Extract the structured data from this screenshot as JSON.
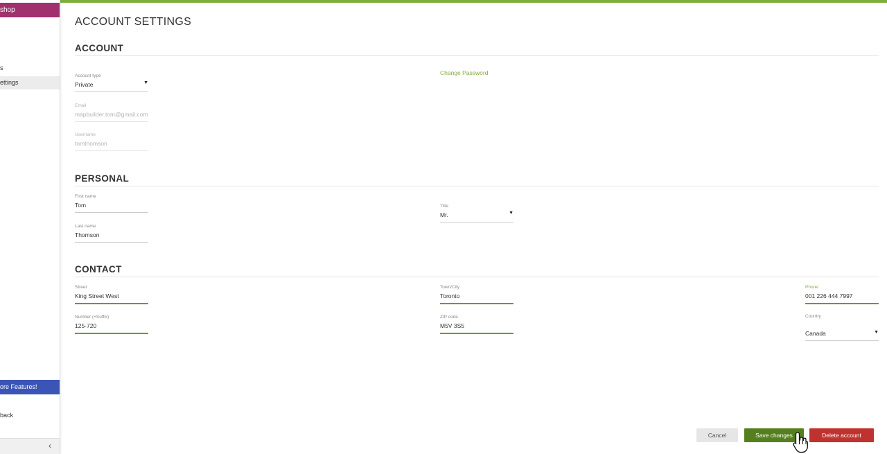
{
  "sidebar": {
    "brand": "shop",
    "items": [
      {
        "label": "s",
        "active": false
      },
      {
        "label": "ettings",
        "active": true
      }
    ],
    "features_label": "ore Features!",
    "feedback_label": "back",
    "collapse_icon": "chevron-left-icon"
  },
  "page": {
    "title": "ACCOUNT SETTINGS"
  },
  "account": {
    "title": "ACCOUNT",
    "account_type": {
      "label": "Account type",
      "value": "Private"
    },
    "email": {
      "label": "Email",
      "value": "mapbuilder.tom@gmail.com"
    },
    "username": {
      "label": "Username",
      "value": "tomthomson"
    },
    "change_password": "Change Password"
  },
  "personal": {
    "title": "PERSONAL",
    "first_name": {
      "label": "First name",
      "value": "Tom"
    },
    "last_name": {
      "label": "Last name",
      "value": "Thomson"
    },
    "title_field": {
      "label": "Title",
      "value": "Mr."
    }
  },
  "contact": {
    "title": "CONTACT",
    "street": {
      "label": "Street",
      "value": "King Street West"
    },
    "number": {
      "label": "Number (+Suffix)",
      "value": "125-720"
    },
    "town": {
      "label": "Town/City",
      "value": "Toronto"
    },
    "zip": {
      "label": "ZIP code",
      "value": "M5V 3S5"
    },
    "phone": {
      "label": "Phone",
      "value": "001 226 444 7997"
    },
    "country": {
      "label": "Country",
      "value": "Canada"
    }
  },
  "actions": {
    "cancel": "Cancel",
    "save": "Save changes",
    "delete": "Delete account"
  },
  "colors": {
    "accent_green": "#7fae3f",
    "save_green": "#557f1f",
    "danger_red": "#c0322f",
    "brand_magenta": "#a1306e",
    "features_blue": "#3a55b6"
  }
}
